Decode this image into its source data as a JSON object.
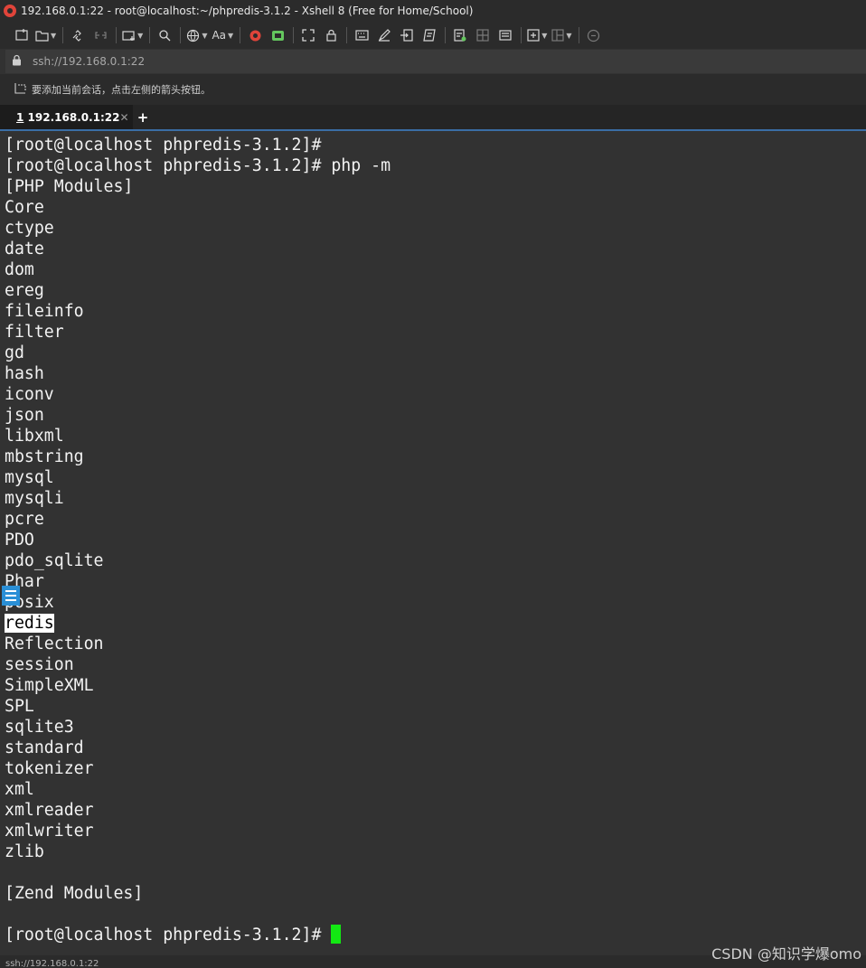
{
  "window": {
    "title": "192.168.0.1:22 - root@localhost:~/phpredis-3.1.2 - Xshell 8 (Free for Home/School)"
  },
  "toolbar": {
    "icons": [
      "new-session-icon",
      "open-folder-icon",
      "connect-icon",
      "disconnect-icon",
      "new-tab-icon",
      "find-icon",
      "globe-icon",
      "font-icon",
      "xshell-icon",
      "xftp-icon",
      "fullscreen-icon",
      "lock-icon",
      "keyboard-icon",
      "compose-icon",
      "transfer-icon",
      "script-icon",
      "log-icon",
      "tile-icon",
      "highlight-icon",
      "add-layout-icon",
      "layout-icon",
      "chat-icon"
    ],
    "font_label": "Aa"
  },
  "address": {
    "value": "ssh://192.168.0.1:22"
  },
  "infobar": {
    "message": "要添加当前会话，点击左侧的箭头按钮。"
  },
  "tabs": [
    {
      "number": "1",
      "label": " 192.168.0.1:22",
      "status_color": "#31d031"
    }
  ],
  "terminal": {
    "lines": [
      "[root@localhost phpredis-3.1.2]#",
      "[root@localhost phpredis-3.1.2]# php -m",
      "[PHP Modules]",
      "Core",
      "ctype",
      "date",
      "dom",
      "ereg",
      "fileinfo",
      "filter",
      "gd",
      "hash",
      "iconv",
      "json",
      "libxml",
      "mbstring",
      "mysql",
      "mysqli",
      "pcre",
      "PDO",
      "pdo_sqlite",
      "Phar",
      "posix",
      "redis",
      "Reflection",
      "session",
      "SimpleXML",
      "SPL",
      "sqlite3",
      "standard",
      "tokenizer",
      "xml",
      "xmlreader",
      "xmlwriter",
      "zlib",
      "",
      "[Zend Modules]",
      "",
      "[root@localhost phpredis-3.1.2]# "
    ],
    "highlighted_line": "redis",
    "cursor_color": "#13e813"
  },
  "statusbar": {
    "text": "ssh://192.168.0.1:22"
  },
  "watermark": "CSDN @知识学爆omo"
}
